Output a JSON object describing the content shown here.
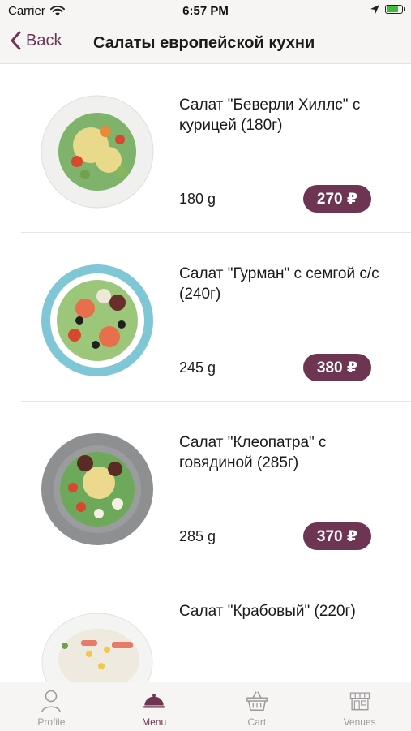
{
  "status_bar": {
    "carrier": "Carrier",
    "time": "6:57 PM",
    "battery_level": 0.8
  },
  "nav": {
    "back_label": "Back",
    "title": "Салаты европейской кухни"
  },
  "items": [
    {
      "name": "Салат \"Беверли Хиллс\" с курицей (180г)",
      "weight": "180 g",
      "price": "270 ₽"
    },
    {
      "name": "Салат \"Гурман\" с семгой с/с (240г)",
      "weight": "245 g",
      "price": "380 ₽"
    },
    {
      "name": "Салат \"Клеопатра\" с говядиной (285г)",
      "weight": "285 g",
      "price": "370 ₽"
    },
    {
      "name": "Салат \"Крабовый\" (220г)",
      "weight": "",
      "price": ""
    }
  ],
  "tabs": [
    {
      "label": "Profile",
      "icon": "person-icon"
    },
    {
      "label": "Menu",
      "icon": "cloche-icon",
      "active": true
    },
    {
      "label": "Cart",
      "icon": "basket-icon"
    },
    {
      "label": "Venues",
      "icon": "storefront-icon"
    }
  ],
  "colors": {
    "accent": "#6e3553",
    "bar_background": "#f7f4f4",
    "inactive_tab": "#9b9b9b"
  }
}
